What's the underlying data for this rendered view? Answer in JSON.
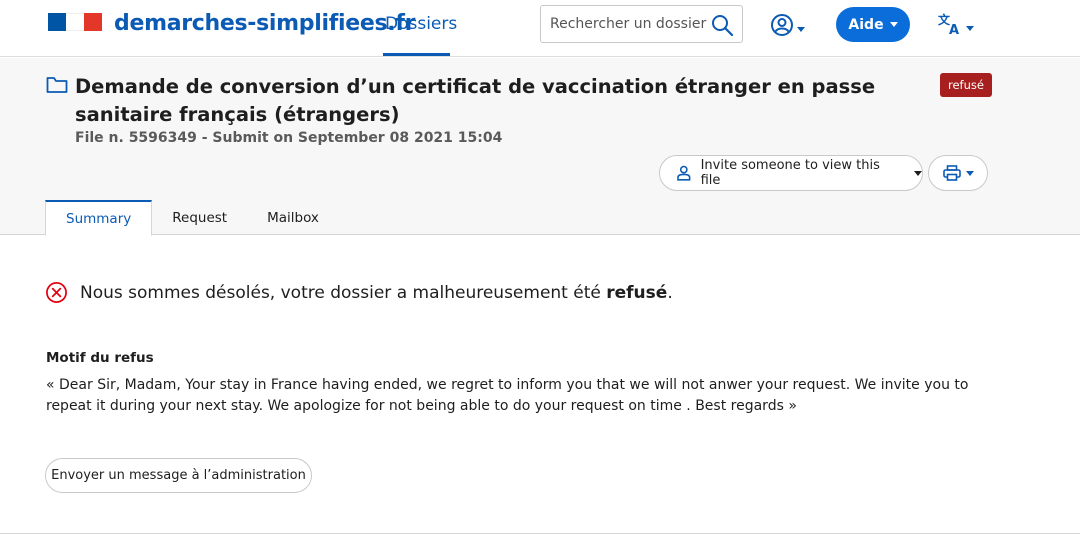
{
  "header": {
    "site_name": "demarches-simplifiees.fr",
    "nav_dossiers": "Dossiers",
    "search_placeholder": "Rechercher un dossier",
    "aide_label": "Aide",
    "lang_icon": "translate-icon",
    "account_icon": "user-circle-icon"
  },
  "dossier": {
    "title": "Demande de conversion d’un certificat de vaccination étranger en passe sanitaire français (étrangers)",
    "status": "refusé",
    "file_info": "File n. 5596349 - Submit on September 08 2021 15:04",
    "invite_label": "Invite someone to view this file",
    "tabs": [
      {
        "label": "Summary",
        "active": true
      },
      {
        "label": "Request",
        "active": false
      },
      {
        "label": "Mailbox",
        "active": false
      }
    ]
  },
  "main": {
    "refuse_prefix": "Nous sommes désolés, votre dossier a malheureusement été ",
    "refuse_bold": "refusé",
    "refuse_suffix": ".",
    "motif_title": "Motif du refus",
    "motif_text": "« Dear Sir, Madam, Your stay in France having ended, we regret to inform you that we will not anwer your request. We invite you to repeat it during your next stay. We apologize for not being able to do your request on time . Best regards »",
    "message_button": "Envoyer un message à l’administration"
  },
  "colors": {
    "brand_blue": "#0b5bb5",
    "aide_blue": "#0b6dd9",
    "refused_red": "#a71f1f",
    "error_red": "#e1000f"
  }
}
